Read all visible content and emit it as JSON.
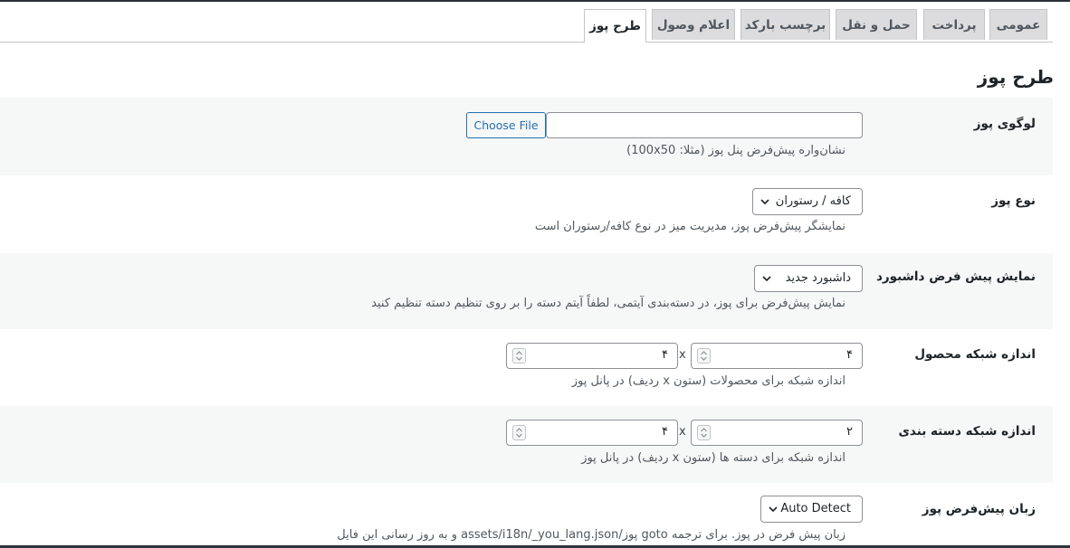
{
  "tabs": [
    {
      "label": "عمومی",
      "active": false
    },
    {
      "label": "پرداخت",
      "active": false
    },
    {
      "label": "حمل و نقل",
      "active": false
    },
    {
      "label": "برچسب بارکد",
      "active": false
    },
    {
      "label": "اعلام وصول",
      "active": false
    },
    {
      "label": "طرح پوز",
      "active": true
    }
  ],
  "page_title": "طرح پوز",
  "fields": {
    "logo": {
      "label": "لوگوی پوز",
      "button_label": "Choose File",
      "value": "",
      "description": "نشان‌واره پیش‌فرض پنل پوز (مثلا: 100x50)"
    },
    "pos_type": {
      "label": "نوع پوز",
      "selected": "کافه / رستوران",
      "description": "نمایشگر پیش‌فرض پوز، مدیریت میز در نوع کافه/رستوران است"
    },
    "default_dashboard": {
      "label": "نمایش پیش فرض داشبورد",
      "selected": "داشبورد جدید",
      "description": "نمایش پیش‌فرض برای پوز، در دسته‌بندی آیتمی، لطفاً آیتم دسته را بر روی تنظیم دسته تنظیم کنید"
    },
    "product_grid": {
      "label": "اندازه شبکه محصول",
      "columns": "۴",
      "rows": "۴",
      "separator": "x",
      "description": "اندازه شبکه برای محصولات (ستون x ردیف) در پانل پوز"
    },
    "category_grid": {
      "label": "اندازه شبکه دسته بندی",
      "columns": "۲",
      "rows": "۴",
      "separator": "x",
      "description": "اندازه شبکه برای دسته ها (ستون x ردیف) در پانل پوز"
    },
    "language": {
      "label": "زبان پیش‌فرض پوز",
      "selected": "Auto Detect",
      "description": "زبان پیش فرض در پوز. برای ترجمه goto پوز/assets/i18n/_you_lang.json و به روز رسانی این فایل"
    }
  },
  "colors": {
    "accent": "#2271b1",
    "tab_bg": "#dcdcde",
    "row_shade": "#f6f7f7",
    "border": "#8c8f94"
  },
  "icons": {
    "select_arrow": "chevron-down-icon",
    "spinner": "spinner-arrows-icon"
  }
}
